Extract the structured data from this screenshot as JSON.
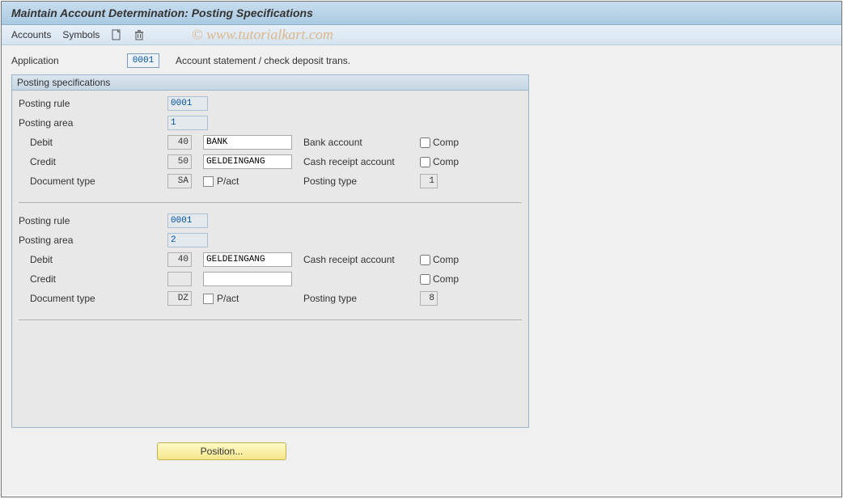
{
  "header": {
    "title": "Maintain Account Determination: Posting Specifications"
  },
  "toolbar": {
    "accounts": "Accounts",
    "symbols": "Symbols"
  },
  "watermark": "© www.tutorialkart.com",
  "application": {
    "label": "Application",
    "value": "0001",
    "description": "Account statement / check deposit trans."
  },
  "group": {
    "title": "Posting specifications",
    "labels": {
      "posting_rule": "Posting rule",
      "posting_area": "Posting area",
      "debit": "Debit",
      "credit": "Credit",
      "document_type": "Document type",
      "pact": "P/act",
      "posting_type": "Posting type",
      "comp": "Comp"
    },
    "blocks": [
      {
        "posting_rule": "0001",
        "posting_area": "1",
        "debit_code": "40",
        "debit_name": "BANK",
        "debit_desc": "Bank account",
        "credit_code": "50",
        "credit_name": "GELDEINGANG",
        "credit_desc": "Cash receipt account",
        "doc_type": "SA",
        "posting_type": "1"
      },
      {
        "posting_rule": "0001",
        "posting_area": "2",
        "debit_code": "40",
        "debit_name": "GELDEINGANG",
        "debit_desc": "Cash receipt account",
        "credit_code": "",
        "credit_name": "",
        "credit_desc": "",
        "doc_type": "DZ",
        "posting_type": "8"
      }
    ]
  },
  "buttons": {
    "position": "Position..."
  }
}
